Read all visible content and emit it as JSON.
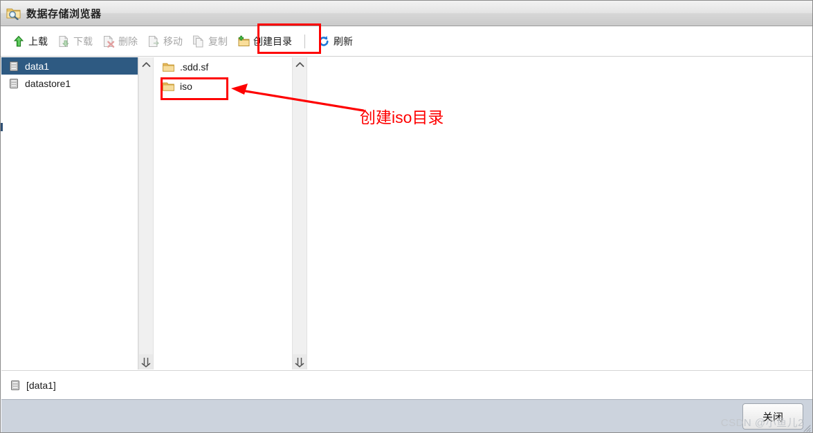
{
  "window": {
    "title": "数据存储浏览器",
    "title_icon": "folder-search-icon"
  },
  "toolbar": {
    "items": [
      {
        "label": "上载",
        "icon": "upload-arrow-icon",
        "enabled": true
      },
      {
        "label": "下载",
        "icon": "download-file-icon",
        "enabled": false
      },
      {
        "label": "删除",
        "icon": "delete-file-icon",
        "enabled": false
      },
      {
        "label": "移动",
        "icon": "move-file-icon",
        "enabled": false
      },
      {
        "label": "复制",
        "icon": "copy-file-icon",
        "enabled": false
      },
      {
        "label": "创建目录",
        "icon": "new-folder-icon",
        "enabled": true
      },
      {
        "label": "刷新",
        "icon": "refresh-icon",
        "enabled": true
      }
    ],
    "upload_label": "上载",
    "download_label": "下载",
    "delete_label": "删除",
    "move_label": "移动",
    "copy_label": "复制",
    "create_dir_label": "创建目录",
    "refresh_label": "刷新"
  },
  "datastores": {
    "items": [
      {
        "label": "data1",
        "icon": "datastore-icon",
        "selected": true
      },
      {
        "label": "datastore1",
        "icon": "datastore-icon",
        "selected": false
      }
    ]
  },
  "folders": {
    "items": [
      {
        "label": ".sdd.sf",
        "icon": "folder-icon",
        "highlighted": false
      },
      {
        "label": "iso",
        "icon": "folder-icon",
        "highlighted": true
      }
    ]
  },
  "annotations": {
    "create_dir_note": "创建iso目录",
    "color": "#fe0000"
  },
  "statusbar": {
    "path": "[data1]",
    "icon": "datastore-icon"
  },
  "footer": {
    "close_label": "关闭"
  },
  "watermark": {
    "text": "CSDN @小鱼儿2"
  },
  "colors": {
    "selection": "#2e5a82",
    "annotation_red": "#fe0000",
    "footer_bg": "#ccd3dd",
    "link_blue": "#1a5fb4"
  }
}
